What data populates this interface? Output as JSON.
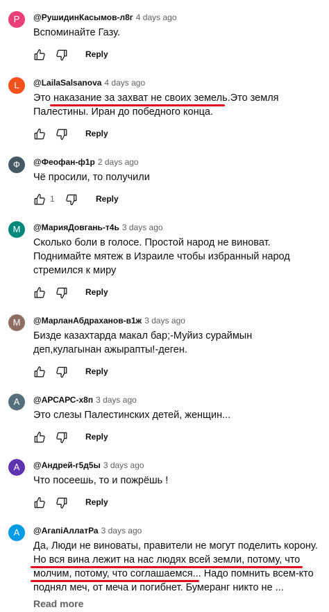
{
  "comments": [
    {
      "initial": "Р",
      "avatar_color": "#ec407a",
      "author": "@РушидинКасымов-л8г",
      "time": "4 days ago",
      "text": "Вспоминайте Газу.",
      "likes": "",
      "reply": "Reply"
    },
    {
      "initial": "L",
      "avatar_color": "#f4511e",
      "author": "@LailaSalsanova",
      "time": "4 days ago",
      "text": "Это наказание за захват не своих земель.Это земля Палестины. Иран до победного конца.",
      "likes": "",
      "reply": "Reply"
    },
    {
      "initial": "Ф",
      "avatar_color": "#455a64",
      "author": "@Феофан-ф1р",
      "time": "2 days ago",
      "text": "Чё просили, то получили",
      "likes": "1",
      "reply": "Reply"
    },
    {
      "initial": "М",
      "avatar_color": "#00897b",
      "author": "@МарияДовгань-т4ь",
      "time": "3 days ago",
      "text": "Сколько боли в голосе. Простой народ не виноват. Поднимайте мятеж в Израиле чтобы избранный народ стремился к миру",
      "likes": "",
      "reply": "Reply"
    },
    {
      "initial": "М",
      "avatar_color": "#8d6e63",
      "author": "@МарланАбдраханов-в1ж",
      "time": "3 days ago",
      "text": "Бизде казахтарда макал  бар;-Муйиз сураймын деп,кулагынан ажырапты!-деген.",
      "likes": "",
      "reply": "Reply"
    },
    {
      "initial": "А",
      "avatar_color": "#546e7a",
      "author": "@АРСАРС-х8п",
      "time": "3 days ago",
      "text": "Это слезы Палестинских детей, женщин...",
      "likes": "",
      "reply": "Reply"
    },
    {
      "initial": "А",
      "avatar_color": "#5e35b1",
      "author": "@Андрей-г5д5ы",
      "time": "3 days ago",
      "text": "Что посеешь, то и пожрёшь !",
      "likes": "",
      "reply": "Reply"
    },
    {
      "initial": "А",
      "avatar_color": "#039be5",
      "author": "@АгапіАллатРа",
      "time": "3 days ago",
      "text": "Да, Люди не виноваты, правители не могут поделить корону. Но вся вина лежит на нас людях всей земли, потому, что молчим, потому, что соглашаемся... Надо помнить всем-кто поднял меч, от меча и погибнет. Бумеранг никто не ...",
      "likes": "",
      "reply": "",
      "read_more": "Read more"
    }
  ],
  "colors": {
    "underline": "#e0101c"
  },
  "icons": {
    "like": "thumb-up-icon",
    "dislike": "thumb-down-icon"
  }
}
